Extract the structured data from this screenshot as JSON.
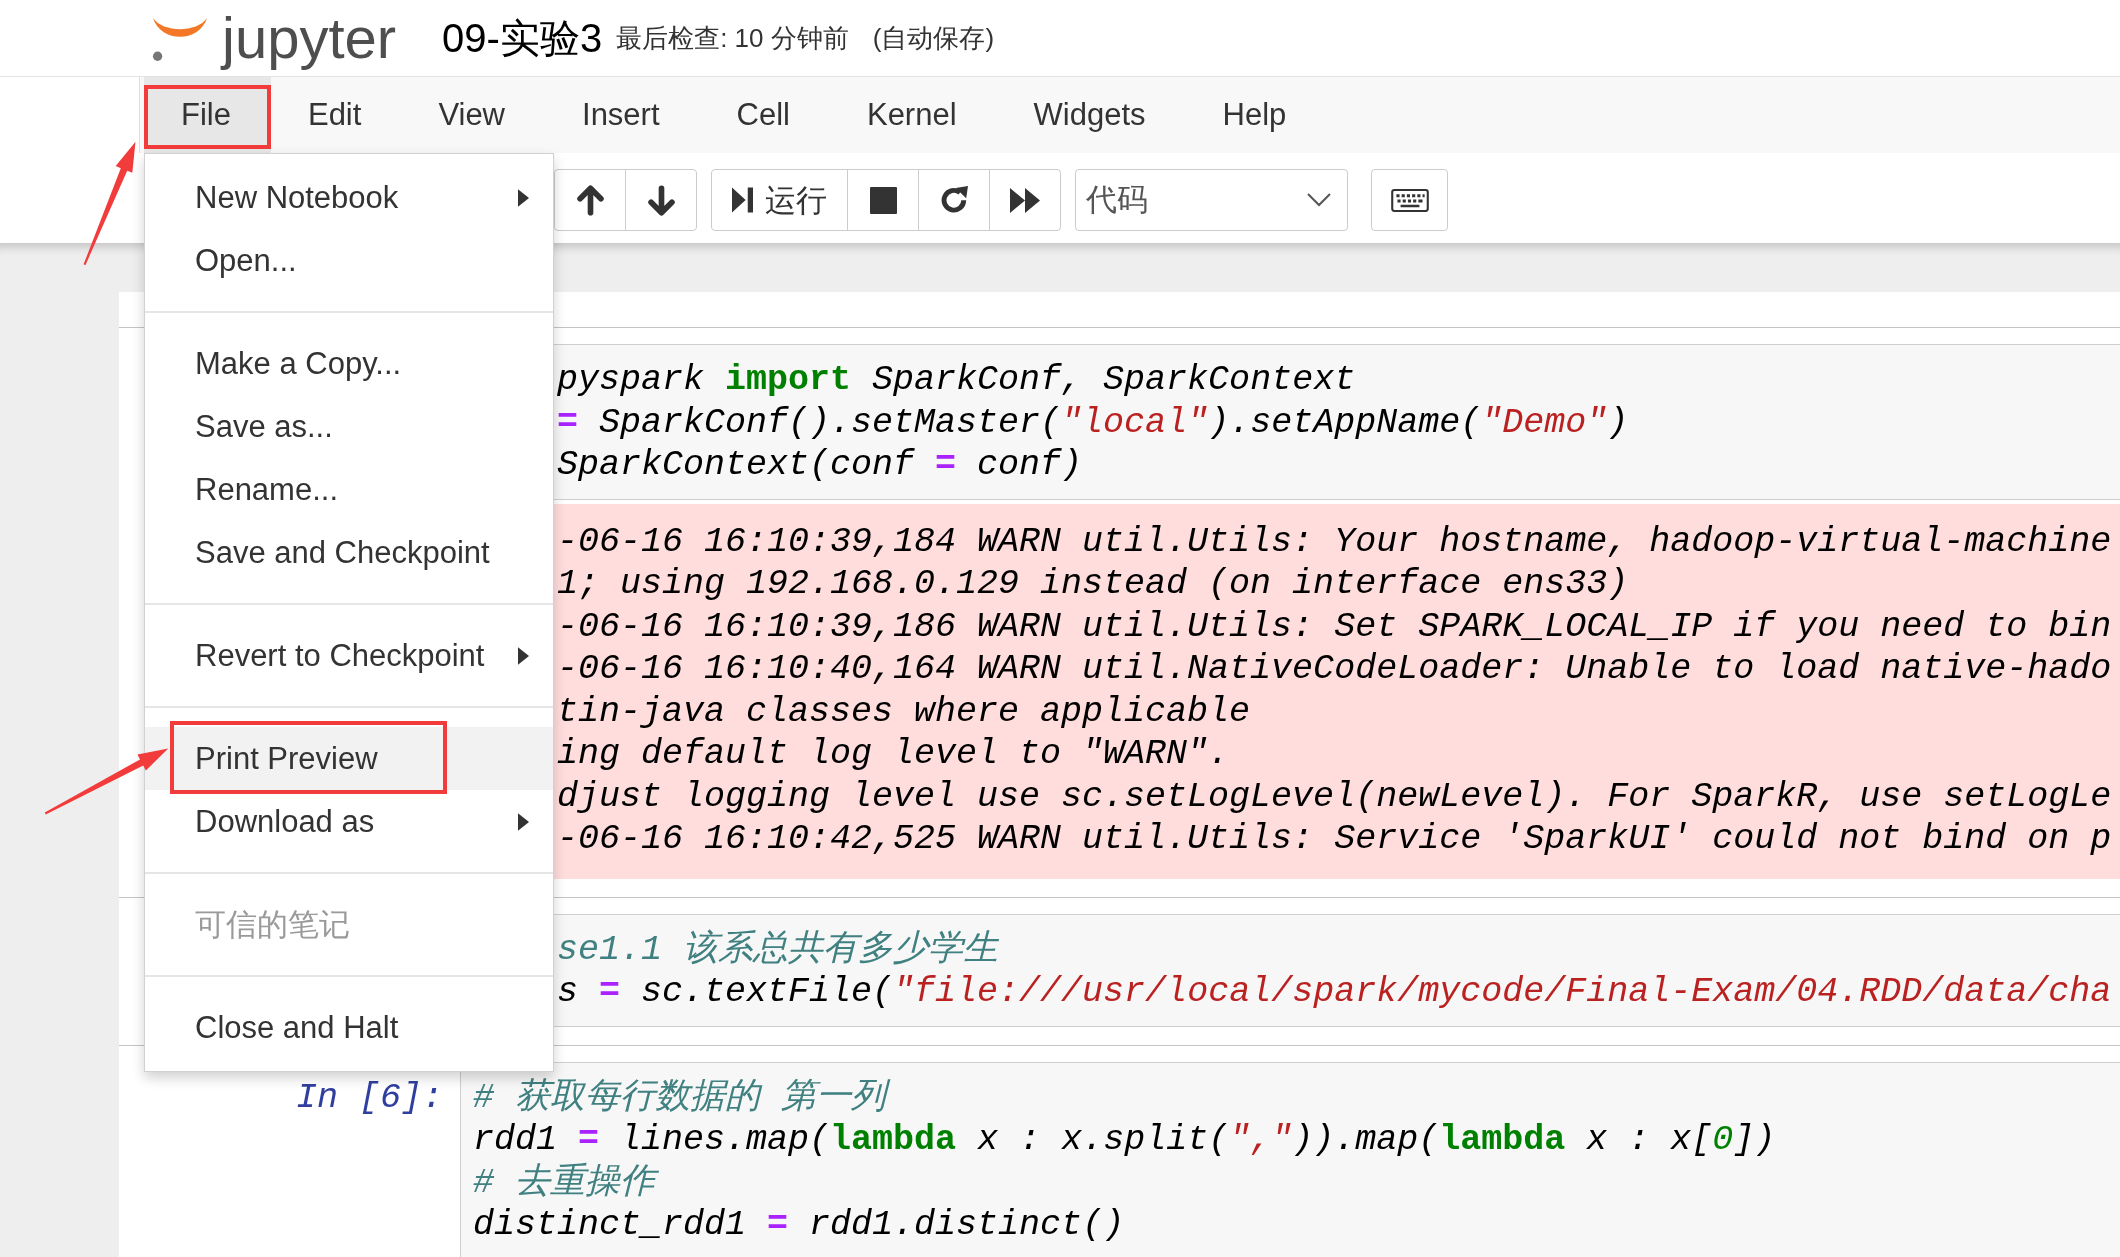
{
  "header": {
    "logo_text": "jupyter",
    "notebook_title": "09-实验3",
    "last_checkpoint": "最后检查: 10 分钟前",
    "autosave": "(自动保存)"
  },
  "menubar": [
    {
      "label": "File",
      "selected": true,
      "annotated": true
    },
    {
      "label": "Edit",
      "selected": false,
      "annotated": false
    },
    {
      "label": "View",
      "selected": false,
      "annotated": false
    },
    {
      "label": "Insert",
      "selected": false,
      "annotated": false
    },
    {
      "label": "Cell",
      "selected": false,
      "annotated": false
    },
    {
      "label": "Kernel",
      "selected": false,
      "annotated": false
    },
    {
      "label": "Widgets",
      "selected": false,
      "annotated": false
    },
    {
      "label": "Help",
      "selected": false,
      "annotated": false
    }
  ],
  "file_menu": {
    "groups": [
      {
        "items": [
          {
            "label": "New Notebook",
            "submenu": true,
            "disabled": false,
            "highlighted": false,
            "annotated": false
          },
          {
            "label": "Open...",
            "submenu": false,
            "disabled": false,
            "highlighted": false,
            "annotated": false
          }
        ]
      },
      {
        "items": [
          {
            "label": "Make a Copy...",
            "submenu": false,
            "disabled": false,
            "highlighted": false,
            "annotated": false
          },
          {
            "label": "Save as...",
            "submenu": false,
            "disabled": false,
            "highlighted": false,
            "annotated": false
          },
          {
            "label": "Rename...",
            "submenu": false,
            "disabled": false,
            "highlighted": false,
            "annotated": false
          },
          {
            "label": "Save and Checkpoint",
            "submenu": false,
            "disabled": false,
            "highlighted": false,
            "annotated": false
          }
        ]
      },
      {
        "items": [
          {
            "label": "Revert to Checkpoint",
            "submenu": true,
            "disabled": false,
            "highlighted": false,
            "annotated": false
          }
        ]
      },
      {
        "items": [
          {
            "label": "Print Preview",
            "submenu": false,
            "disabled": false,
            "highlighted": true,
            "annotated": true
          },
          {
            "label": "Download as",
            "submenu": true,
            "disabled": false,
            "highlighted": false,
            "annotated": false
          }
        ]
      },
      {
        "items": [
          {
            "label": "可信的笔记",
            "submenu": false,
            "disabled": true,
            "highlighted": false,
            "annotated": false
          }
        ]
      },
      {
        "items": [
          {
            "label": "Close and Halt",
            "submenu": false,
            "disabled": false,
            "highlighted": false,
            "annotated": false
          }
        ]
      }
    ]
  },
  "toolbar": {
    "button_groups": [
      [
        {
          "kind": "move-up"
        },
        {
          "kind": "move-down"
        }
      ],
      [
        {
          "kind": "run",
          "label": "运行"
        },
        {
          "kind": "stop"
        },
        {
          "kind": "restart"
        },
        {
          "kind": "run-all"
        }
      ]
    ],
    "cell_type_select": {
      "value": "代码"
    },
    "keyboard_button": {
      "kind": "keyboard"
    }
  },
  "notebook": {
    "cells": [
      {
        "input": [
          [
            {
              "kind": "plain",
              "text": "pyspark "
            },
            {
              "kind": "keyword",
              "text": "import"
            },
            {
              "kind": "plain",
              "text": " SparkConf, SparkContext"
            }
          ],
          [
            {
              "kind": "operator",
              "text": "="
            },
            {
              "kind": "plain",
              "text": " SparkConf().setMaster("
            },
            {
              "kind": "string",
              "text": "\"local\""
            },
            {
              "kind": "plain",
              "text": ").setAppName("
            },
            {
              "kind": "string",
              "text": "\"Demo\""
            },
            {
              "kind": "plain",
              "text": ")"
            }
          ],
          [
            {
              "kind": "plain",
              "text": "SparkContext(conf "
            },
            {
              "kind": "operator",
              "text": "="
            },
            {
              "kind": "plain",
              "text": " conf)"
            }
          ]
        ],
        "output": {
          "kind": "stderr",
          "lines": [
            "-06-16 16:10:39,184 WARN util.Utils: Your hostname, hadoop-virtual-machine",
            "1; using 192.168.0.129 instead (on interface ens33)",
            "-06-16 16:10:39,186 WARN util.Utils: Set SPARK_LOCAL_IP if you need to bin",
            "-06-16 16:10:40,164 WARN util.NativeCodeLoader: Unable to load native-hado",
            "tin-java classes where applicable",
            "ing default log level to \"WARN\".",
            "djust logging level use sc.setLogLevel(newLevel). For SparkR, use setLogLe",
            "-06-16 16:10:42,525 WARN util.Utils: Service 'SparkUI' could not bind on p"
          ]
        }
      },
      {
        "input": [
          [
            {
              "kind": "comment",
              "text": "se1.1 该系总共有多少学生"
            }
          ],
          [
            {
              "kind": "plain",
              "text": "s "
            },
            {
              "kind": "operator",
              "text": "="
            },
            {
              "kind": "plain",
              "text": " sc.textFile("
            },
            {
              "kind": "string",
              "text": "\"file:///usr/local/spark/mycode/Final-Exam/04.RDD/data/cha"
            }
          ]
        ]
      },
      {
        "prompt": "In [6]:",
        "input": [
          [
            {
              "kind": "comment",
              "text": "# 获取每行数据的 第一列"
            }
          ],
          [
            {
              "kind": "plain",
              "text": "rdd1 "
            },
            {
              "kind": "operator",
              "text": "="
            },
            {
              "kind": "plain",
              "text": " lines.map("
            },
            {
              "kind": "keyword",
              "text": "lambda"
            },
            {
              "kind": "plain",
              "text": " x : x.split("
            },
            {
              "kind": "string",
              "text": "\",\""
            },
            {
              "kind": "plain",
              "text": ")).map("
            },
            {
              "kind": "keyword",
              "text": "lambda"
            },
            {
              "kind": "plain",
              "text": " x : x["
            },
            {
              "kind": "number",
              "text": "0"
            },
            {
              "kind": "plain",
              "text": "])"
            }
          ],
          [
            {
              "kind": "comment",
              "text": "# 去重操作"
            }
          ],
          [
            {
              "kind": "plain",
              "text": "distinct_rdd1 "
            },
            {
              "kind": "operator",
              "text": "="
            },
            {
              "kind": "plain",
              "text": " rdd1.distinct()"
            }
          ]
        ]
      }
    ]
  }
}
